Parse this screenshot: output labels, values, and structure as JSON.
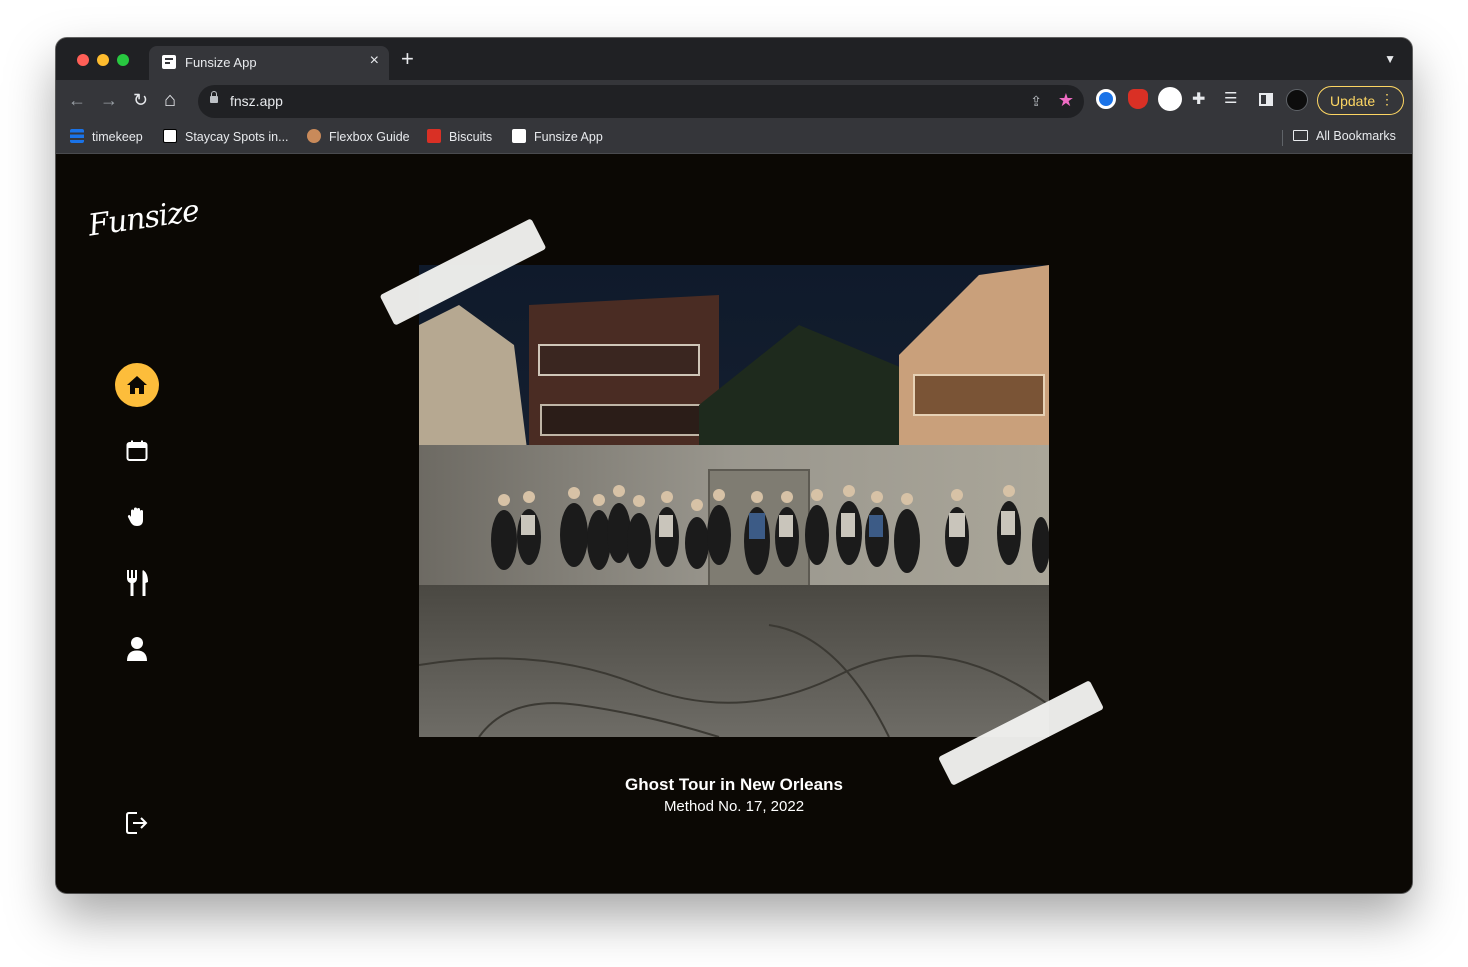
{
  "browser": {
    "tab": {
      "title": "Funsize App",
      "close": "×"
    },
    "new_tab": "+",
    "tab_menu": "⌄",
    "nav": {
      "back": "←",
      "forward": "→",
      "reload": "↻",
      "home": "⌂"
    },
    "url": "fnsz.app",
    "update_label": "Update",
    "update_dots": "⋮",
    "bookmarks": [
      {
        "label": "timekeep",
        "icon": "timekeep-icon"
      },
      {
        "label": "Staycay Spots in...",
        "icon": "notion-icon"
      },
      {
        "label": "Flexbox Guide",
        "icon": "avatar-icon"
      },
      {
        "label": "Biscuits",
        "icon": "biscuits-icon"
      },
      {
        "label": "Funsize App",
        "icon": "funsize-icon"
      }
    ],
    "all_bookmarks": "All Bookmarks"
  },
  "app": {
    "logo": "Funsize",
    "nav_items": [
      {
        "name": "home",
        "icon": "home-icon",
        "active": true
      },
      {
        "name": "calendar",
        "icon": "calendar-icon",
        "active": false
      },
      {
        "name": "activities",
        "icon": "hand-icon",
        "active": false
      },
      {
        "name": "food",
        "icon": "fork-knife-icon",
        "active": false
      },
      {
        "name": "profile",
        "icon": "person-icon",
        "active": false
      }
    ],
    "logout_icon": "logout-icon",
    "accent_color": "#fdbd3b",
    "background_color": "#0b0804",
    "feature": {
      "title": "Ghost Tour in New Orleans",
      "subtitle": "Method No. 17, 2022"
    }
  }
}
